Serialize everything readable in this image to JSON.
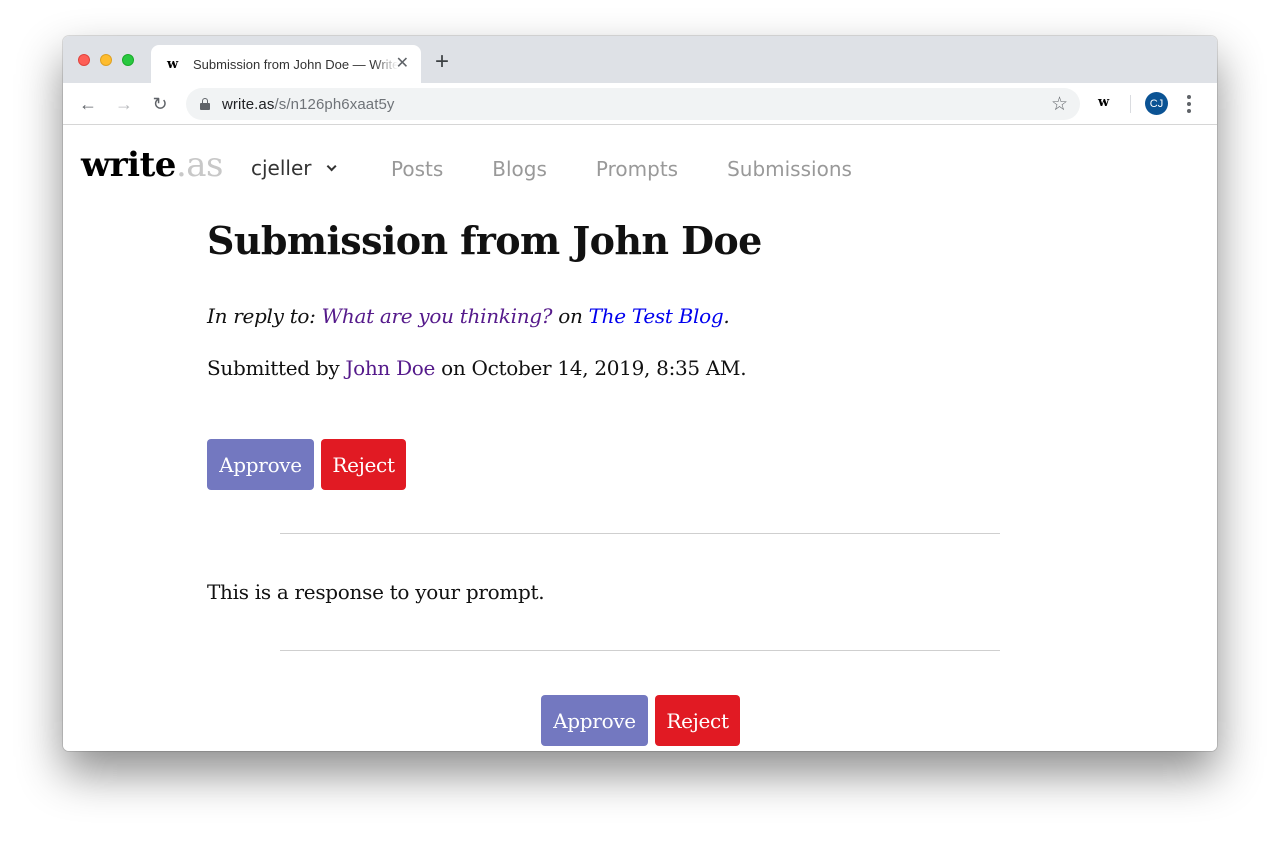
{
  "browser": {
    "tab": {
      "favicon": "w",
      "title": "Submission from John Doe — Write.as"
    },
    "new_tab_label": "+",
    "url_host": "write.as",
    "url_path": "/s/n126ph6xaat5y",
    "extension_label": "w",
    "profile_initials": "CJ",
    "icons": {
      "back": "←",
      "forward": "→",
      "reload": "↻",
      "bookmark": "☆",
      "close_tab": "✕"
    }
  },
  "site": {
    "logo_main": "write",
    "logo_suffix": ".as",
    "user_menu": "cjeller",
    "nav": [
      "Posts",
      "Blogs",
      "Prompts",
      "Submissions"
    ]
  },
  "submission": {
    "title": "Submission from John Doe",
    "reply_prefix": "In reply to: ",
    "prompt_link": "What are you thinking?",
    "reply_on": " on ",
    "blog_link": "The Test Blog",
    "reply_suffix": ".",
    "submitted_prefix": "Submitted by ",
    "author_link": "John Doe",
    "submitted_suffix": " on October 14, 2019, 8:35 AM.",
    "body": "This is a response to your prompt.",
    "approve_label": "Approve",
    "reject_label": "Reject"
  },
  "colors": {
    "approve": "#7378c0",
    "reject": "#e11a23",
    "visited_link": "#551a8b",
    "link": "#0000ee",
    "profile": "#0b5394"
  }
}
